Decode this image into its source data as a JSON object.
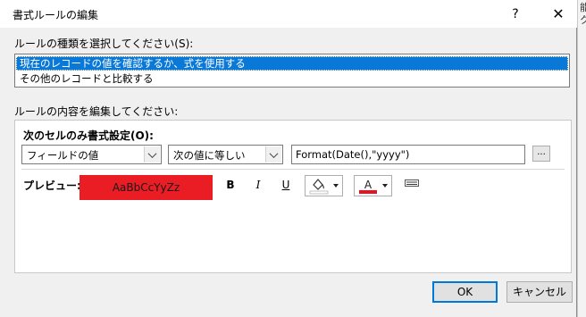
{
  "window": {
    "title": "書式ルールの編集",
    "help": "?",
    "close": "✕"
  },
  "rule_type": {
    "label": "ルールの種類を選択してください(S):",
    "items": [
      {
        "label": "現在のレコードの値を確認するか、式を使用する",
        "selected": true
      },
      {
        "label": "その他のレコードと比較する",
        "selected": false
      }
    ]
  },
  "rule_content": {
    "label": "ルールの内容を編集してください:",
    "cell_format_label": "次のセルのみ書式設定(O):",
    "field_combo": "フィールドの値",
    "operator_combo": "次の値に等しい",
    "expression": "Format(Date(),\"yyyy\")",
    "builder_button": "...",
    "preview_label": "プレビュー:",
    "preview_text": "AaBbCcYyZz",
    "preview_bg": "#ea1c24",
    "bold": "B",
    "italic": "I",
    "underline": "U",
    "fill_color": "#ffffff",
    "font_color": "#e81123"
  },
  "buttons": {
    "ok": "OK",
    "cancel": "キャンセル"
  },
  "background": {
    "glyph1": "能",
    "glyph2": "ク"
  }
}
